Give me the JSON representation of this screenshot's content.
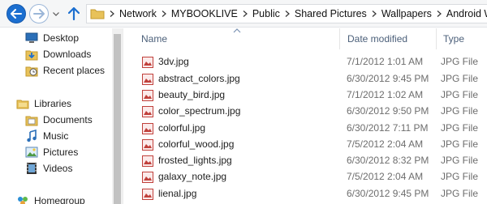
{
  "address_bar": {
    "crumbs": [
      "Network",
      "MYBOOKLIVE",
      "Public",
      "Shared Pictures",
      "Wallpapers",
      "Android Wa"
    ]
  },
  "navigation": {
    "items": [
      {
        "label": "Desktop",
        "icon": "desktop-icon"
      },
      {
        "label": "Downloads",
        "icon": "downloads-icon"
      },
      {
        "label": "Recent places",
        "icon": "recent-places-icon"
      },
      {
        "label": "Libraries",
        "icon": "libraries-icon"
      },
      {
        "label": "Documents",
        "icon": "documents-icon"
      },
      {
        "label": "Music",
        "icon": "music-icon"
      },
      {
        "label": "Pictures",
        "icon": "pictures-icon"
      },
      {
        "label": "Videos",
        "icon": "videos-icon"
      },
      {
        "label": "Homegroup",
        "icon": "homegroup-icon"
      }
    ]
  },
  "columns": {
    "name": "Name",
    "date_modified": "Date modified",
    "type": "Type"
  },
  "files": [
    {
      "name": "3dv.jpg",
      "date": "7/1/2012 1:01 AM",
      "type": "JPG File"
    },
    {
      "name": "abstract_colors.jpg",
      "date": "6/30/2012 9:45 PM",
      "type": "JPG File"
    },
    {
      "name": "beauty_bird.jpg",
      "date": "7/1/2012 1:02 AM",
      "type": "JPG File"
    },
    {
      "name": "color_spectrum.jpg",
      "date": "6/30/2012 9:50 PM",
      "type": "JPG File"
    },
    {
      "name": "colorful.jpg",
      "date": "6/30/2012 7:11 PM",
      "type": "JPG File"
    },
    {
      "name": "colorful_wood.jpg",
      "date": "7/5/2012 2:04 AM",
      "type": "JPG File"
    },
    {
      "name": "frosted_lights.jpg",
      "date": "6/30/2012 8:32 PM",
      "type": "JPG File"
    },
    {
      "name": "galaxy_note.jpg",
      "date": "7/5/2012 2:04 AM",
      "type": "JPG File"
    },
    {
      "name": "lienal.jpg",
      "date": "6/30/2012 9:45 PM",
      "type": "JPG File"
    }
  ],
  "colors": {
    "accent": "#1c6fd0",
    "header_text": "#4c607a",
    "secondary_text": "#6d6d6d"
  }
}
